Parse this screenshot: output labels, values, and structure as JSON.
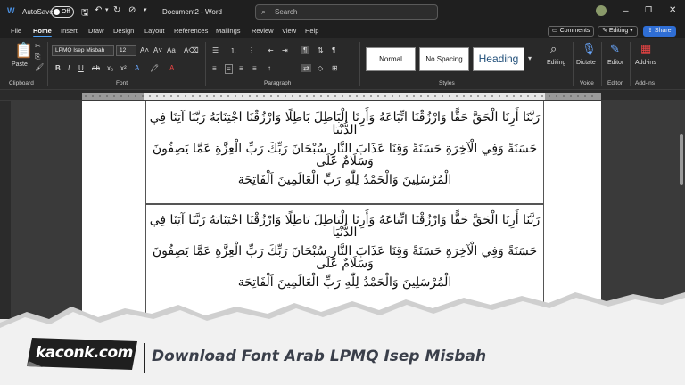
{
  "titlebar": {
    "autosave": "AutoSave",
    "toggle": "Off",
    "doc_title": "Document2 - Word",
    "search_placeholder": "Search",
    "avatar_icon": "user-avatar-icon"
  },
  "menu": {
    "tabs": [
      "File",
      "Home",
      "Insert",
      "Draw",
      "Design",
      "Layout",
      "References",
      "Mailings",
      "Review",
      "View",
      "Help"
    ],
    "comments": "Comments",
    "editing": "Editing",
    "share": "Share"
  },
  "ribbon": {
    "paste": "Paste",
    "clipboard": "Clipboard",
    "font_name": "LPMQ Isep Misbah",
    "font_size": "12",
    "font_group": "Font",
    "paragraph": "Paragraph",
    "styles": [
      "Normal",
      "No Spacing",
      "Heading"
    ],
    "styles_group": "Styles",
    "editing": "Editing",
    "dictate": "Dictate",
    "voice": "Voice",
    "editor": "Editor",
    "editor_group": "Editor",
    "addins": "Add-ins",
    "addins_group": "Add-ins"
  },
  "document": {
    "line1": "رَبَّنَا أَرِنَا الْحَقَّ حَقًّا وَارْزُقْنَا اتِّبَاعَهُ وَأَرِنَا الْبَاطِلَ بَاطِلًا وَارْزُقْنَا اجْتِنَابَهُ رَبَّنَا آتِنَا فِي الدُّنْيَا",
    "line2": "حَسَنَةً وَفِي الْآخِرَةِ حَسَنَةً وَقِنَا عَذَابَ النَّارِ سُبْحَانَ رَبِّكَ رَبِّ الْعِزَّةِ عَمَّا يَصِفُونَ وَسَلَامٌ عَلَى",
    "line3": "الْمُرْسَلِينَ وَالْحَمْدُ لِلّٰهِ رَبِّ الْعَالَمِينَ اَلْفَاتِحَة"
  },
  "banner": {
    "brand": "kaconk.com",
    "title": "Download Font Arab LPMQ Isep Misbah"
  },
  "colors": {
    "accent": "#4a9ef5",
    "share": "#2f6ed5",
    "brand_bg": "#1f1f1f"
  }
}
